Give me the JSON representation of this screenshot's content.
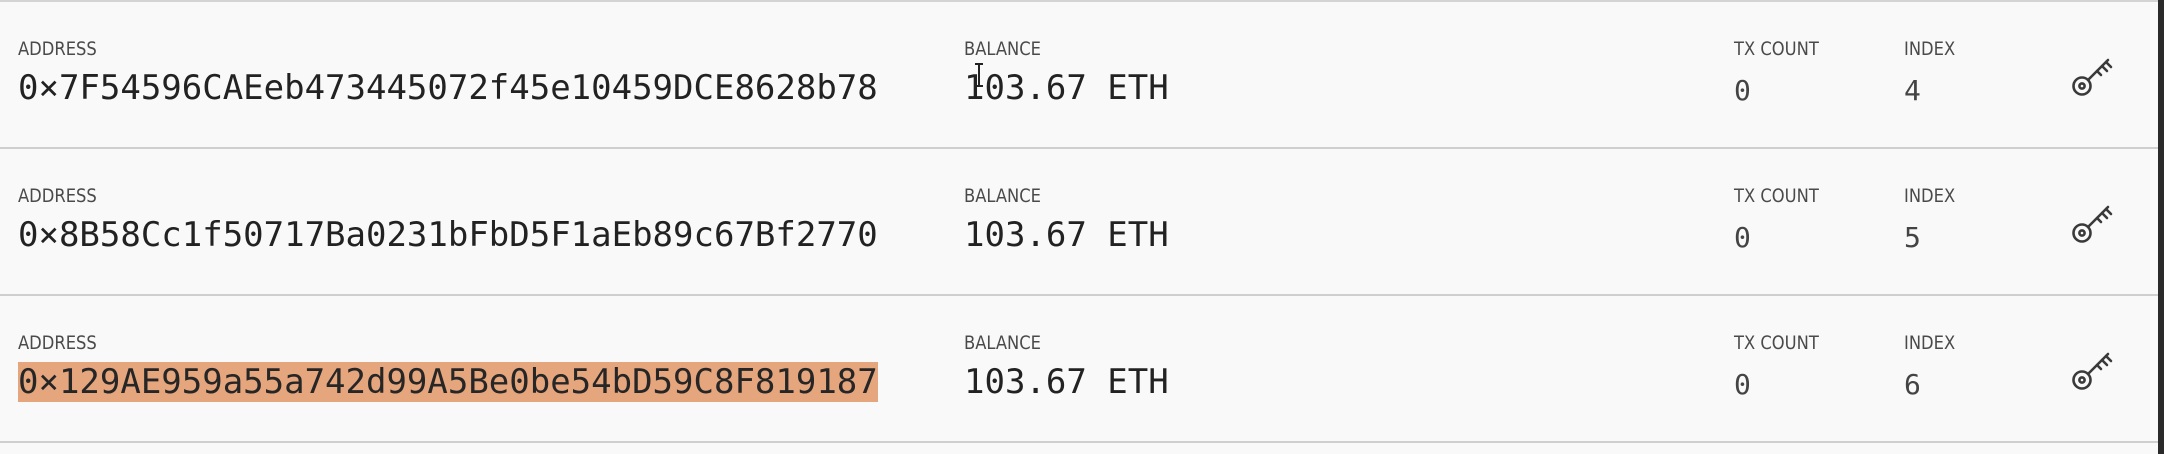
{
  "accounts": [
    {
      "address_label": "ADDRESS",
      "address": "0×7F54596CAEeb473445072f45e10459DCE8628b78",
      "balance_label": "BALANCE",
      "balance": "103.67 ETH",
      "tx_count_label": "TX COUNT",
      "tx_count": "0",
      "index_label": "INDEX",
      "index": "4",
      "selected": false
    },
    {
      "address_label": "ADDRESS",
      "address": "0×8B58Cc1f50717Ba0231bFbD5F1aEb89c67Bf2770",
      "balance_label": "BALANCE",
      "balance": "103.67 ETH",
      "tx_count_label": "TX COUNT",
      "tx_count": "0",
      "index_label": "INDEX",
      "index": "5",
      "selected": false
    },
    {
      "address_label": "ADDRESS",
      "address": "0×129AE959a55a742d99A5Be0be54bD59C8F819187",
      "balance_label": "BALANCE",
      "balance": "103.67 ETH",
      "tx_count_label": "TX COUNT",
      "tx_count": "0",
      "index_label": "INDEX",
      "index": "6",
      "selected": true
    }
  ],
  "icons": {
    "key": "key-icon",
    "cursor": "text-cursor-icon"
  },
  "colors": {
    "background": "#f9f9f9",
    "divider": "#cfcfcf",
    "label": "#4a4a4a",
    "value": "#222222",
    "highlight": "#e5a57d"
  }
}
